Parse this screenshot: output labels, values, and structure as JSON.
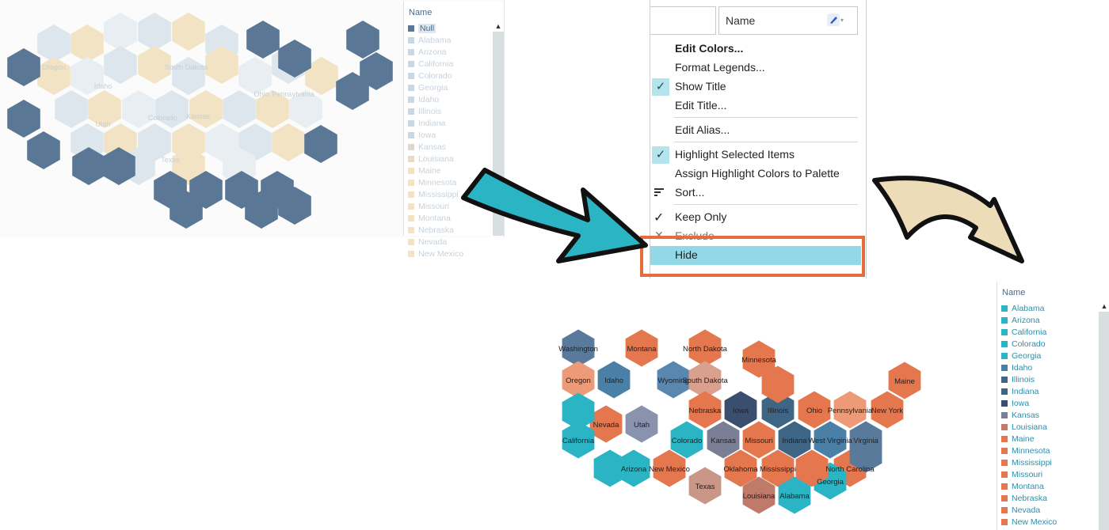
{
  "before": {
    "legend_title": "Name",
    "legend_items": [
      {
        "label": "Null",
        "color": "#5a7896",
        "selected": true
      },
      {
        "label": "Alabama",
        "color": "#c9d9e3"
      },
      {
        "label": "Arizona",
        "color": "#c9d9e3"
      },
      {
        "label": "California",
        "color": "#c9d9e3"
      },
      {
        "label": "Colorado",
        "color": "#c9d9e3"
      },
      {
        "label": "Georgia",
        "color": "#c9d9e3"
      },
      {
        "label": "Idaho",
        "color": "#c9d9e3"
      },
      {
        "label": "Illinois",
        "color": "#c9d9e3"
      },
      {
        "label": "Indiana",
        "color": "#c9d9e3"
      },
      {
        "label": "Iowa",
        "color": "#c9d9e3"
      },
      {
        "label": "Kansas",
        "color": "#e0d8cc"
      },
      {
        "label": "Louisiana",
        "color": "#eadcc4"
      },
      {
        "label": "Maine",
        "color": "#f2e3c4"
      },
      {
        "label": "Minnesota",
        "color": "#f2e3c4"
      },
      {
        "label": "Mississippi",
        "color": "#f2e3c4"
      },
      {
        "label": "Missouri",
        "color": "#f2e3c4"
      },
      {
        "label": "Montana",
        "color": "#f2e3c4"
      },
      {
        "label": "Nebraska",
        "color": "#f2e3c4"
      },
      {
        "label": "Nevada",
        "color": "#f2e3c4"
      },
      {
        "label": "New Mexico",
        "color": "#f2e3c4"
      }
    ],
    "faded_labels": [
      "Oregon",
      "Idaho",
      "Utah",
      "South Dakota",
      "Ohio",
      "Pennsylvania",
      "Colorado",
      "Texas",
      "Kansas"
    ]
  },
  "menu": {
    "legend_name": "Name",
    "items": {
      "edit_colors": "Edit Colors...",
      "format_legends": "Format Legends...",
      "show_title": "Show Title",
      "edit_title": "Edit Title...",
      "edit_alias": "Edit Alias...",
      "highlight_selected": "Highlight Selected Items",
      "assign_highlight": "Assign Highlight Colors to Palette",
      "sort": "Sort...",
      "keep_only": "Keep Only",
      "exclude": "Exclude",
      "hide": "Hide"
    },
    "checked": [
      "show_title",
      "highlight_selected"
    ]
  },
  "after": {
    "legend_title": "Name",
    "legend_items": [
      {
        "label": "Alabama",
        "color": "#2bb5c4"
      },
      {
        "label": "Arizona",
        "color": "#2bb5c4"
      },
      {
        "label": "California",
        "color": "#2bb5c4"
      },
      {
        "label": "Colorado",
        "color": "#2bb5c4"
      },
      {
        "label": "Georgia",
        "color": "#2bb5c4"
      },
      {
        "label": "Idaho",
        "color": "#4a7fa6"
      },
      {
        "label": "Illinois",
        "color": "#3f6585"
      },
      {
        "label": "Indiana",
        "color": "#3f6585"
      },
      {
        "label": "Iowa",
        "color": "#3a4f6e"
      },
      {
        "label": "Kansas",
        "color": "#7a7f96"
      },
      {
        "label": "Louisiana",
        "color": "#c07a6a"
      },
      {
        "label": "Maine",
        "color": "#e5774e"
      },
      {
        "label": "Minnesota",
        "color": "#e5774e"
      },
      {
        "label": "Mississippi",
        "color": "#e5774e"
      },
      {
        "label": "Missouri",
        "color": "#e5774e"
      },
      {
        "label": "Montana",
        "color": "#e5774e"
      },
      {
        "label": "Nebraska",
        "color": "#e5774e"
      },
      {
        "label": "Nevada",
        "color": "#e5774e"
      },
      {
        "label": "New Mexico",
        "color": "#e5774e"
      }
    ],
    "states": [
      {
        "name": "Washington",
        "color": "#5a7a9c",
        "label": true
      },
      {
        "name": "Montana",
        "color": "#e5774e",
        "label": true
      },
      {
        "name": "North Dakota",
        "color": "#e5774e",
        "label": true
      },
      {
        "name": "Minnesota",
        "color": "#e5774e",
        "label": true
      },
      {
        "name": "Maine",
        "color": "#e5774e",
        "label": true
      },
      {
        "name": "Oregon",
        "color": "#ec9a78",
        "label": true
      },
      {
        "name": "Idaho",
        "color": "#4a7fa6",
        "label": true
      },
      {
        "name": "Wyoming",
        "color": "#5a87b0",
        "label": true
      },
      {
        "name": "South Dakota",
        "color": "#d9a08e",
        "label": true
      },
      {
        "name": "Nevada",
        "color": "#e5774e",
        "label": true
      },
      {
        "name": "Utah",
        "color": "#8a93ad",
        "label": true
      },
      {
        "name": "Nebraska",
        "color": "#e5774e",
        "label": true
      },
      {
        "name": "Iowa",
        "color": "#3a4f6e",
        "label": true
      },
      {
        "name": "Illinois",
        "color": "#3f6585",
        "label": true
      },
      {
        "name": "Ohio",
        "color": "#e5774e",
        "label": true
      },
      {
        "name": "Pennsylvania",
        "color": "#ec9a78",
        "label": true
      },
      {
        "name": "New York",
        "color": "#e5774e",
        "label": true
      },
      {
        "name": "California",
        "color": "#2bb5c4",
        "label": true
      },
      {
        "name": "Colorado",
        "color": "#2bb5c4",
        "label": true
      },
      {
        "name": "Kansas",
        "color": "#7a7f96",
        "label": true
      },
      {
        "name": "Missouri",
        "color": "#e5774e",
        "label": true
      },
      {
        "name": "Indiana",
        "color": "#3f6585",
        "label": true
      },
      {
        "name": "West Virginia",
        "color": "#4a7fa6",
        "label": true
      },
      {
        "name": "Virginia",
        "color": "#5a7a9c",
        "label": true
      },
      {
        "name": "Arizona",
        "color": "#2bb5c4",
        "label": true
      },
      {
        "name": "New Mexico",
        "color": "#e5774e",
        "label": true
      },
      {
        "name": "Oklahoma",
        "color": "#e5774e",
        "label": true
      },
      {
        "name": "Mississippi",
        "color": "#e5774e",
        "label": true
      },
      {
        "name": "North Carolina",
        "color": "#e5774e",
        "label": true
      },
      {
        "name": "Texas",
        "color": "#c99688",
        "label": true
      },
      {
        "name": "Louisiana",
        "color": "#c07a6a",
        "label": true
      },
      {
        "name": "Alabama",
        "color": "#2bb5c4",
        "label": true
      },
      {
        "name": "Georgia",
        "color": "#2bb5c4",
        "label": true
      },
      {
        "name": "",
        "color": "#2bb5c4",
        "label": false
      },
      {
        "name": "",
        "color": "#2bb5c4",
        "label": false
      },
      {
        "name": "",
        "color": "#e5774e",
        "label": false
      },
      {
        "name": "",
        "color": "#e5774e",
        "label": false
      },
      {
        "name": "",
        "color": "#5a7a9c",
        "label": false
      }
    ]
  },
  "colors": {
    "menu_highlight": "#93d8e6",
    "check_bg": "#b6e4ec",
    "hide_outline": "#e66d3a",
    "arrow1": "#2bb5c4",
    "arrow2": "#ecdcb8"
  }
}
